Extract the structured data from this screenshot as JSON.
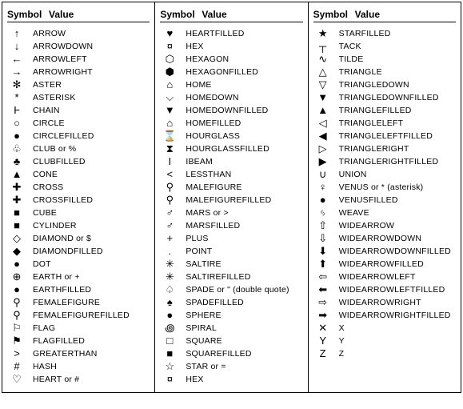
{
  "headers": {
    "symbol": "Symbol",
    "value": "Value"
  },
  "columns": [
    {
      "rows": [
        {
          "sym": "↑",
          "val": "ARROW"
        },
        {
          "sym": "↓",
          "val": "ARROWDOWN"
        },
        {
          "sym": "←",
          "val": "ARROWLEFT"
        },
        {
          "sym": "→",
          "val": "ARROWRIGHT"
        },
        {
          "sym": "✻",
          "val": "ASTER"
        },
        {
          "sym": "*",
          "val": "ASTERISK"
        },
        {
          "sym": "Ⱶ",
          "val": "CHAIN"
        },
        {
          "sym": "○",
          "val": "CIRCLE"
        },
        {
          "sym": "●",
          "val": "CIRCLEFILLED"
        },
        {
          "sym": "♧",
          "val": "CLUB or %"
        },
        {
          "sym": "♣",
          "val": "CLUBFILLED"
        },
        {
          "sym": "▲",
          "val": "CONE"
        },
        {
          "sym": "✚",
          "val": "CROSS"
        },
        {
          "sym": "✚",
          "val": "CROSSFILLED"
        },
        {
          "sym": "■",
          "val": "CUBE"
        },
        {
          "sym": "■",
          "val": "CYLINDER"
        },
        {
          "sym": "◇",
          "val": "DIAMOND or $"
        },
        {
          "sym": "◆",
          "val": "DIAMONDFILLED"
        },
        {
          "sym": "●",
          "val": "DOT"
        },
        {
          "sym": "⊕",
          "val": "EARTH or +"
        },
        {
          "sym": "●",
          "val": "EARTHFILLED"
        },
        {
          "sym": "⚲",
          "val": "FEMALEFIGURE"
        },
        {
          "sym": "⚲",
          "val": "FEMALEFIGUREFILLED"
        },
        {
          "sym": "⚐",
          "val": "FLAG"
        },
        {
          "sym": "⚑",
          "val": "FLAGFILLED"
        },
        {
          "sym": ">",
          "val": "GREATERTHAN"
        },
        {
          "sym": "#",
          "val": "HASH"
        },
        {
          "sym": "♡",
          "val": "HEART or #"
        }
      ]
    },
    {
      "rows": [
        {
          "sym": "♥",
          "val": "HEARTFILLED"
        },
        {
          "sym": "¤",
          "val": "HEX"
        },
        {
          "sym": "⬡",
          "val": "HEXAGON"
        },
        {
          "sym": "⬢",
          "val": "HEXAGONFILLED"
        },
        {
          "sym": "⌂",
          "val": "HOME"
        },
        {
          "sym": "⌵",
          "val": "HOMEDOWN"
        },
        {
          "sym": "▼",
          "val": "HOMEDOWNFILLED"
        },
        {
          "sym": "⌂",
          "val": "HOMEFILLED"
        },
        {
          "sym": "⌛",
          "val": "HOURGLASS"
        },
        {
          "sym": "⧗",
          "val": "HOURGLASSFILLED"
        },
        {
          "sym": "I",
          "val": "IBEAM"
        },
        {
          "sym": "<",
          "val": "LESSTHAN"
        },
        {
          "sym": "⚲",
          "val": "MALEFIGURE"
        },
        {
          "sym": "⚲",
          "val": "MALEFIGUREFILLED"
        },
        {
          "sym": "♂",
          "val": "MARS or >"
        },
        {
          "sym": "♂",
          "val": "MARSFILLED"
        },
        {
          "sym": "+",
          "val": "PLUS"
        },
        {
          "sym": ".",
          "val": "POINT"
        },
        {
          "sym": "✳",
          "val": "SALTIRE"
        },
        {
          "sym": "✳",
          "val": "SALTIREFILLED"
        },
        {
          "sym": "♤",
          "val": "SPADE or \" (double quote)"
        },
        {
          "sym": "♠",
          "val": "SPADEFILLED"
        },
        {
          "sym": "●",
          "val": "SPHERE"
        },
        {
          "sym": "꩜",
          "val": "SPIRAL"
        },
        {
          "sym": "□",
          "val": "SQUARE"
        },
        {
          "sym": "■",
          "val": "SQUAREFILLED"
        },
        {
          "sym": "☆",
          "val": "STAR or ="
        },
        {
          "sym": "¤",
          "val": "HEX"
        }
      ]
    },
    {
      "rows": [
        {
          "sym": "★",
          "val": "STARFILLED"
        },
        {
          "sym": "┬",
          "val": "TACK"
        },
        {
          "sym": "∿",
          "val": "TILDE"
        },
        {
          "sym": "△",
          "val": "TRIANGLE"
        },
        {
          "sym": "▽",
          "val": "TRIANGLEDOWN"
        },
        {
          "sym": "▼",
          "val": "TRIANGLEDOWNFILLED"
        },
        {
          "sym": "▲",
          "val": "TRIANGLEFILLED"
        },
        {
          "sym": "◁",
          "val": "TRIANGLELEFT"
        },
        {
          "sym": "◀",
          "val": "TRIANGLELEFTFILLED"
        },
        {
          "sym": "▷",
          "val": "TRIANGLERIGHT"
        },
        {
          "sym": "▶",
          "val": "TRIANGLERIGHTFILLED"
        },
        {
          "sym": "∪",
          "val": "UNION"
        },
        {
          "sym": "♀",
          "val": "VENUS or * (asterisk)"
        },
        {
          "sym": "●",
          "val": "VENUSFILLED"
        },
        {
          "sym": "ᛃ",
          "val": "WEAVE"
        },
        {
          "sym": "⇧",
          "val": "WIDEARROW"
        },
        {
          "sym": "⇩",
          "val": "WIDEARROWDOWN"
        },
        {
          "sym": "⬇",
          "val": "WIDEARROWDOWNFILLED"
        },
        {
          "sym": "⬆",
          "val": "WIDEARROWFILLED"
        },
        {
          "sym": "⇦",
          "val": "WIDEARROWLEFT"
        },
        {
          "sym": "⬅",
          "val": "WIDEARROWLEFTFILLED"
        },
        {
          "sym": "⇨",
          "val": "WIDEARROWRIGHT"
        },
        {
          "sym": "➡",
          "val": "WIDEARROWRIGHTFILLED"
        },
        {
          "sym": "✕",
          "val": "X"
        },
        {
          "sym": "Y",
          "val": "Y"
        },
        {
          "sym": "Z",
          "val": "Z"
        }
      ]
    }
  ]
}
